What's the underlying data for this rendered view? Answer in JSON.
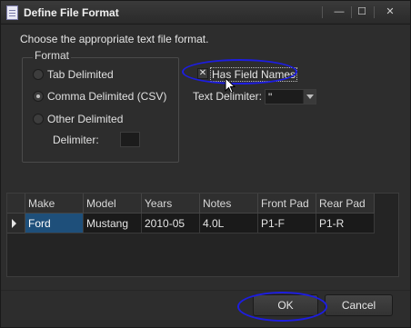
{
  "window": {
    "title": "Define File Format",
    "controls": {
      "minimize": "—",
      "maximize": "☐",
      "close": "✕"
    }
  },
  "instructions": "Choose the  appropriate text file format.",
  "format_group": {
    "legend": "Format",
    "options": [
      {
        "label": "Tab Delimited",
        "checked": false
      },
      {
        "label": "Comma Delimited (CSV)",
        "checked": true
      },
      {
        "label": "Other Delimited",
        "checked": false
      }
    ],
    "delimiter_label": "Delimiter:",
    "delimiter_value": ""
  },
  "has_field_names": {
    "label": "Has Field Names",
    "checked": true,
    "mark": "✕"
  },
  "text_delimiter": {
    "label": "Text Delimiter:",
    "value": "\""
  },
  "grid": {
    "columns": [
      "Make",
      "Model",
      "Years",
      "Notes",
      "Front Pad",
      "Rear Pad"
    ],
    "rows": [
      [
        "Ford",
        "Mustang",
        "2010-05",
        "4.0L",
        "P1-F",
        "P1-R"
      ]
    ]
  },
  "buttons": {
    "ok": "OK",
    "cancel": "Cancel"
  },
  "annotation_color": "#1d1de0",
  "selection_color": "#1e4f7a"
}
